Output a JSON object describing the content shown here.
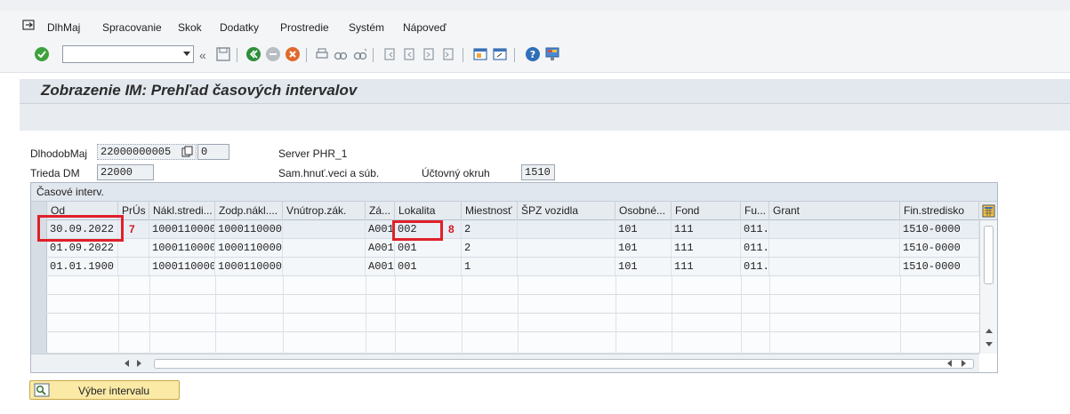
{
  "menu": {
    "items": [
      "DlhMaj",
      "Spracovanie",
      "Skok",
      "Dodatky",
      "Prostredie",
      "Systém",
      "Nápoveď"
    ]
  },
  "toolbar": {
    "command_field": {
      "value": "",
      "placeholder": ""
    },
    "back_label": "«"
  },
  "screen": {
    "title": "Zobrazenie IM: Prehľad časových intervalov"
  },
  "header": {
    "dlhodobmaj": {
      "label": "DlhodobMaj",
      "value": "22000000005",
      "sub_value": "0"
    },
    "trieda": {
      "label": "Trieda DM",
      "value": "22000"
    },
    "server": "Server PHR_1",
    "sam_hnut": "Sam.hnuť.veci a súb.",
    "uctovny": {
      "label": "Účtovný okruh",
      "value": "1510"
    }
  },
  "table": {
    "title": "Časové interv.",
    "columns": [
      "Od",
      "PrÚs",
      "Nákl.stredi...",
      "Zodp.nákl....",
      "Vnútrop.zák.",
      "Zá...",
      "Lokalita",
      "Miestnosť",
      "ŠPZ vozidla",
      "Osobné...",
      "Fond",
      "Fu...",
      "Grant",
      "Fin.stredisko"
    ],
    "rows": [
      [
        "30.09.2022",
        "",
        "1000110000",
        "1000110000",
        "",
        "A001",
        "002",
        "2",
        "",
        "101",
        "111",
        "011...",
        "",
        "1510-0000"
      ],
      [
        "01.09.2022",
        "",
        "1000110000",
        "1000110000",
        "",
        "A001",
        "001",
        "2",
        "",
        "101",
        "111",
        "011...",
        "",
        "1510-0000"
      ],
      [
        "01.01.1900",
        "",
        "1000110000",
        "1000110000",
        "",
        "A001",
        "001",
        "1",
        "",
        "101",
        "111",
        "011...",
        "",
        "1510-0000"
      ]
    ],
    "annotations": [
      "7",
      "8"
    ]
  },
  "buttons": {
    "vyber_intervalu": "Výber intervalu"
  },
  "colors": {
    "highlight": "#e0202a",
    "button_bg": "#fbe9a6",
    "header_bg": "#e6ebf0"
  }
}
